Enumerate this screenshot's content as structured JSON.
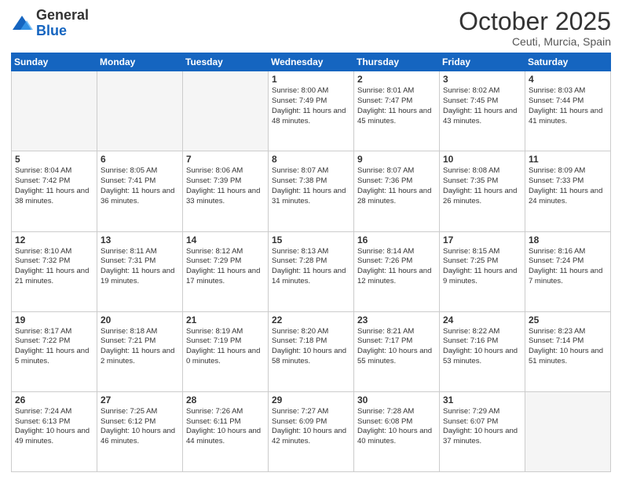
{
  "header": {
    "logo_general": "General",
    "logo_blue": "Blue",
    "month": "October 2025",
    "location": "Ceuti, Murcia, Spain"
  },
  "weekdays": [
    "Sunday",
    "Monday",
    "Tuesday",
    "Wednesday",
    "Thursday",
    "Friday",
    "Saturday"
  ],
  "weeks": [
    [
      {
        "day": "",
        "info": ""
      },
      {
        "day": "",
        "info": ""
      },
      {
        "day": "",
        "info": ""
      },
      {
        "day": "1",
        "info": "Sunrise: 8:00 AM\nSunset: 7:49 PM\nDaylight: 11 hours\nand 48 minutes."
      },
      {
        "day": "2",
        "info": "Sunrise: 8:01 AM\nSunset: 7:47 PM\nDaylight: 11 hours\nand 45 minutes."
      },
      {
        "day": "3",
        "info": "Sunrise: 8:02 AM\nSunset: 7:45 PM\nDaylight: 11 hours\nand 43 minutes."
      },
      {
        "day": "4",
        "info": "Sunrise: 8:03 AM\nSunset: 7:44 PM\nDaylight: 11 hours\nand 41 minutes."
      }
    ],
    [
      {
        "day": "5",
        "info": "Sunrise: 8:04 AM\nSunset: 7:42 PM\nDaylight: 11 hours\nand 38 minutes."
      },
      {
        "day": "6",
        "info": "Sunrise: 8:05 AM\nSunset: 7:41 PM\nDaylight: 11 hours\nand 36 minutes."
      },
      {
        "day": "7",
        "info": "Sunrise: 8:06 AM\nSunset: 7:39 PM\nDaylight: 11 hours\nand 33 minutes."
      },
      {
        "day": "8",
        "info": "Sunrise: 8:07 AM\nSunset: 7:38 PM\nDaylight: 11 hours\nand 31 minutes."
      },
      {
        "day": "9",
        "info": "Sunrise: 8:07 AM\nSunset: 7:36 PM\nDaylight: 11 hours\nand 28 minutes."
      },
      {
        "day": "10",
        "info": "Sunrise: 8:08 AM\nSunset: 7:35 PM\nDaylight: 11 hours\nand 26 minutes."
      },
      {
        "day": "11",
        "info": "Sunrise: 8:09 AM\nSunset: 7:33 PM\nDaylight: 11 hours\nand 24 minutes."
      }
    ],
    [
      {
        "day": "12",
        "info": "Sunrise: 8:10 AM\nSunset: 7:32 PM\nDaylight: 11 hours\nand 21 minutes."
      },
      {
        "day": "13",
        "info": "Sunrise: 8:11 AM\nSunset: 7:31 PM\nDaylight: 11 hours\nand 19 minutes."
      },
      {
        "day": "14",
        "info": "Sunrise: 8:12 AM\nSunset: 7:29 PM\nDaylight: 11 hours\nand 17 minutes."
      },
      {
        "day": "15",
        "info": "Sunrise: 8:13 AM\nSunset: 7:28 PM\nDaylight: 11 hours\nand 14 minutes."
      },
      {
        "day": "16",
        "info": "Sunrise: 8:14 AM\nSunset: 7:26 PM\nDaylight: 11 hours\nand 12 minutes."
      },
      {
        "day": "17",
        "info": "Sunrise: 8:15 AM\nSunset: 7:25 PM\nDaylight: 11 hours\nand 9 minutes."
      },
      {
        "day": "18",
        "info": "Sunrise: 8:16 AM\nSunset: 7:24 PM\nDaylight: 11 hours\nand 7 minutes."
      }
    ],
    [
      {
        "day": "19",
        "info": "Sunrise: 8:17 AM\nSunset: 7:22 PM\nDaylight: 11 hours\nand 5 minutes."
      },
      {
        "day": "20",
        "info": "Sunrise: 8:18 AM\nSunset: 7:21 PM\nDaylight: 11 hours\nand 2 minutes."
      },
      {
        "day": "21",
        "info": "Sunrise: 8:19 AM\nSunset: 7:19 PM\nDaylight: 11 hours\nand 0 minutes."
      },
      {
        "day": "22",
        "info": "Sunrise: 8:20 AM\nSunset: 7:18 PM\nDaylight: 10 hours\nand 58 minutes."
      },
      {
        "day": "23",
        "info": "Sunrise: 8:21 AM\nSunset: 7:17 PM\nDaylight: 10 hours\nand 55 minutes."
      },
      {
        "day": "24",
        "info": "Sunrise: 8:22 AM\nSunset: 7:16 PM\nDaylight: 10 hours\nand 53 minutes."
      },
      {
        "day": "25",
        "info": "Sunrise: 8:23 AM\nSunset: 7:14 PM\nDaylight: 10 hours\nand 51 minutes."
      }
    ],
    [
      {
        "day": "26",
        "info": "Sunrise: 7:24 AM\nSunset: 6:13 PM\nDaylight: 10 hours\nand 49 minutes."
      },
      {
        "day": "27",
        "info": "Sunrise: 7:25 AM\nSunset: 6:12 PM\nDaylight: 10 hours\nand 46 minutes."
      },
      {
        "day": "28",
        "info": "Sunrise: 7:26 AM\nSunset: 6:11 PM\nDaylight: 10 hours\nand 44 minutes."
      },
      {
        "day": "29",
        "info": "Sunrise: 7:27 AM\nSunset: 6:09 PM\nDaylight: 10 hours\nand 42 minutes."
      },
      {
        "day": "30",
        "info": "Sunrise: 7:28 AM\nSunset: 6:08 PM\nDaylight: 10 hours\nand 40 minutes."
      },
      {
        "day": "31",
        "info": "Sunrise: 7:29 AM\nSunset: 6:07 PM\nDaylight: 10 hours\nand 37 minutes."
      },
      {
        "day": "",
        "info": ""
      }
    ]
  ]
}
